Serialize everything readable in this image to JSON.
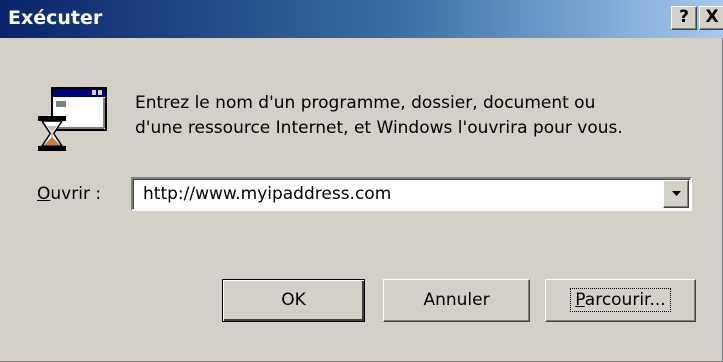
{
  "window": {
    "title": "Exécuter",
    "help_button": "?",
    "close_button": "X"
  },
  "icon": {
    "name": "run-program-hourglass-icon"
  },
  "message": {
    "line1": "Entrez le nom d'un programme, dossier, document ou",
    "line2": "d'une ressource Internet, et Windows l'ouvrira pour vous."
  },
  "open_field": {
    "label_mnemonic": "O",
    "label_rest": "uvrir :",
    "value": "http://www.myipaddress.com"
  },
  "buttons": {
    "ok": "OK",
    "cancel": "Annuler",
    "browse_mnemonic": "P",
    "browse_rest": "arcourir..."
  },
  "colors": {
    "title_start": "#0a246a",
    "title_end": "#a6caf0",
    "face": "#d4d0c8"
  }
}
